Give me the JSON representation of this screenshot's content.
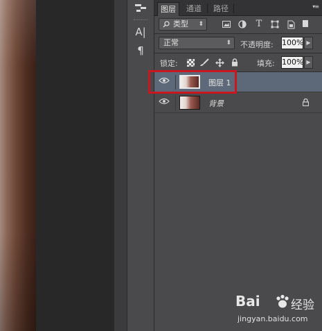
{
  "panel": {
    "tabs": [
      {
        "label": "图层",
        "active": true
      },
      {
        "label": "通道",
        "active": false
      },
      {
        "label": "路径",
        "active": false
      }
    ],
    "menu_icon": "panel-menu-icon"
  },
  "toolbar_strip": {
    "items": [
      "brush-preset-icon",
      "character-panel-icon",
      "paragraph-panel-icon"
    ],
    "character_glyph": "A|",
    "paragraph_glyph": "¶"
  },
  "filter": {
    "kind_label": "类型",
    "filter_icons": [
      "image-filter-icon",
      "adjustment-filter-icon",
      "type-filter-icon",
      "shape-filter-icon",
      "smart-object-filter-icon"
    ]
  },
  "blend": {
    "mode": "正常",
    "opacity_label": "不透明度:",
    "opacity_value": "100%"
  },
  "lock": {
    "label": "锁定:",
    "icons": [
      "lock-transparent-icon",
      "lock-image-icon",
      "lock-position-icon",
      "lock-all-icon"
    ],
    "fill_label": "填充:",
    "fill_value": "100%"
  },
  "layers": [
    {
      "name": "图层 1",
      "selected": true,
      "visible": true,
      "locked": false
    },
    {
      "name": "背景",
      "selected": false,
      "visible": true,
      "locked": true
    }
  ],
  "watermark": {
    "logo_text": "Bai",
    "cn_text": "经验",
    "url": "jingyan.baidu.com"
  },
  "colors": {
    "selection": "#5d6878",
    "highlight_box": "#c8171e",
    "panel_bg": "#4a4a4c"
  }
}
